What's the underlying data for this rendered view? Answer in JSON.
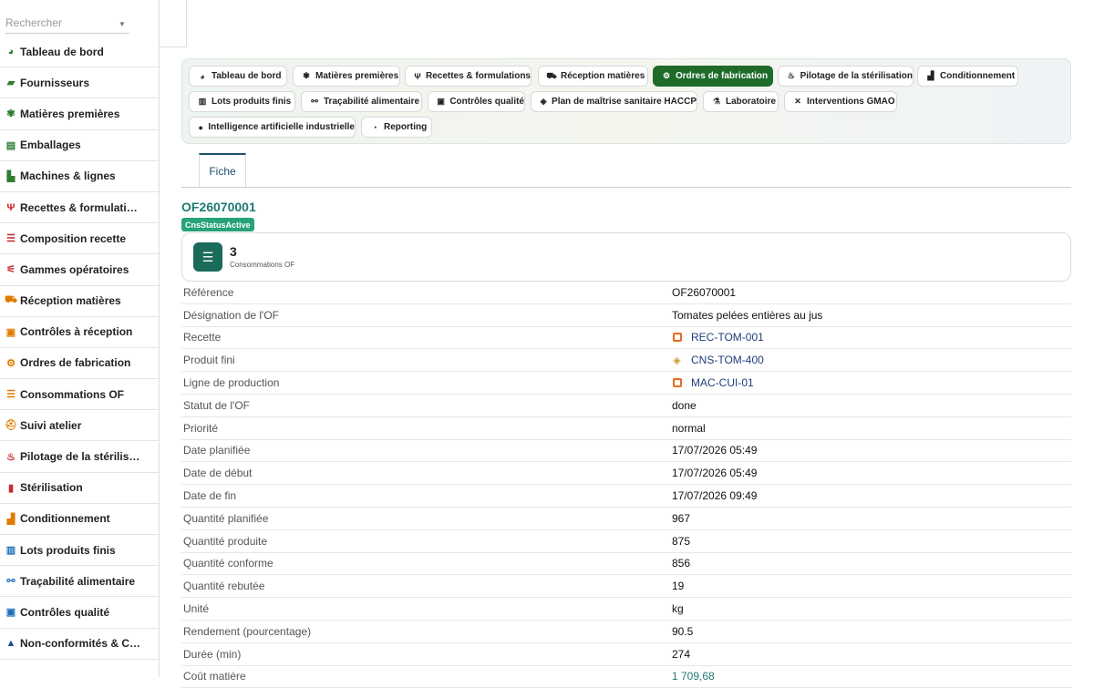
{
  "sidebar": {
    "search_placeholder": "Rechercher",
    "items": [
      {
        "label": "Tableau de bord",
        "icon": "gauge-icon",
        "glyph": "◕",
        "color": "#2e7d32"
      },
      {
        "label": "Fournisseurs",
        "icon": "truck-icon",
        "glyph": "▰",
        "color": "#2e7d32"
      },
      {
        "label": "Matières premières",
        "icon": "seedling-icon",
        "glyph": "✾",
        "color": "#2e7d32"
      },
      {
        "label": "Emballages",
        "icon": "box-icon",
        "glyph": "▤",
        "color": "#2e7d32"
      },
      {
        "label": "Machines & lignes",
        "icon": "factory-icon",
        "glyph": "▙",
        "color": "#2e7d32"
      },
      {
        "label": "Recettes & formulati…",
        "icon": "utensils-icon",
        "glyph": "Ψ",
        "color": "#c62828"
      },
      {
        "label": "Composition recette",
        "icon": "list-icon",
        "glyph": "☰",
        "color": "#c62828"
      },
      {
        "label": "Gammes opératoires",
        "icon": "diagram-icon",
        "glyph": "⚟",
        "color": "#c62828"
      },
      {
        "label": "Réception matières",
        "icon": "dolly-icon",
        "glyph": "⛟",
        "color": "#e07b00"
      },
      {
        "label": "Contrôles à réception",
        "icon": "clipboard-check-icon",
        "glyph": "▣",
        "color": "#e07b00"
      },
      {
        "label": "Ordres de fabrication",
        "icon": "gears-icon",
        "glyph": "⚙",
        "color": "#e07b00"
      },
      {
        "label": "Consommations OF",
        "icon": "list-icon",
        "glyph": "☰",
        "color": "#e07b00"
      },
      {
        "label": "Suivi atelier",
        "icon": "helmet-icon",
        "glyph": "⛑",
        "color": "#e07b00"
      },
      {
        "label": "Pilotage de la stérilis…",
        "icon": "fire-icon",
        "glyph": "♨",
        "color": "#c62828"
      },
      {
        "label": "Stérilisation",
        "icon": "thermometer-icon",
        "glyph": "▮",
        "color": "#c62828"
      },
      {
        "label": "Conditionnement",
        "icon": "boxes-icon",
        "glyph": "▟",
        "color": "#e07b00"
      },
      {
        "label": "Lots produits finis",
        "icon": "barcode-icon",
        "glyph": "▥",
        "color": "#1e6fb8"
      },
      {
        "label": "Traçabilité alimentaire",
        "icon": "sitemap-icon",
        "glyph": "⚯",
        "color": "#1e6fb8"
      },
      {
        "label": "Contrôles qualité",
        "icon": "clipboard-check-icon",
        "glyph": "▣",
        "color": "#1e6fb8"
      },
      {
        "label": "Non-conformités & C…",
        "icon": "warning-icon",
        "glyph": "▲",
        "color": "#1e4e8e"
      }
    ]
  },
  "tabs": {
    "pills": [
      {
        "label": "Tableau de bord",
        "icon": "gauge-icon",
        "glyph": "◕",
        "active": false
      },
      {
        "label": "Matières premières",
        "icon": "seedling-icon",
        "glyph": "✾",
        "active": false
      },
      {
        "label": "Recettes & formulations",
        "icon": "utensils-icon",
        "glyph": "Ψ",
        "active": false
      },
      {
        "label": "Réception matières",
        "icon": "dolly-icon",
        "glyph": "⛟",
        "active": false
      },
      {
        "label": "Ordres de fabrication",
        "icon": "gears-icon",
        "glyph": "⚙",
        "active": true
      },
      {
        "label": "Pilotage de la stérilisation",
        "icon": "fire-icon",
        "glyph": "♨",
        "active": false
      },
      {
        "label": "Conditionnement",
        "icon": "boxes-icon",
        "glyph": "▟",
        "active": false
      },
      {
        "label": "Lots produits finis",
        "icon": "barcode-icon",
        "glyph": "▥",
        "active": false
      },
      {
        "label": "Traçabilité alimentaire",
        "icon": "sitemap-icon",
        "glyph": "⚯",
        "active": false
      },
      {
        "label": "Contrôles qualité",
        "icon": "clipboard-check-icon",
        "glyph": "▣",
        "active": false
      },
      {
        "label": "Plan de maîtrise sanitaire HACCP",
        "icon": "shield-icon",
        "glyph": "◈",
        "active": false
      },
      {
        "label": "Laboratoire",
        "icon": "flask-icon",
        "glyph": "⚗",
        "active": false
      },
      {
        "label": "Interventions GMAO",
        "icon": "tools-icon",
        "glyph": "✕",
        "active": false
      },
      {
        "label": "Intelligence artificielle industrielle",
        "icon": "lightbulb-icon",
        "glyph": "●",
        "active": false
      },
      {
        "label": "Reporting",
        "icon": "pie-chart-icon",
        "glyph": "◔",
        "active": false
      }
    ],
    "fiche_label": "Fiche"
  },
  "record": {
    "title": "OF26070001",
    "status_badge": "CnsStatusActive",
    "stat": {
      "value": "3",
      "label": "Consommations OF"
    },
    "fields": [
      {
        "label": "Référence",
        "value": "OF26070001",
        "kind": "text"
      },
      {
        "label": "Désignation de l'OF",
        "value": "Tomates pelées entières au jus",
        "kind": "text"
      },
      {
        "label": "Recette",
        "value": "REC-TOM-001",
        "kind": "link",
        "icon": "recipe-box-icon"
      },
      {
        "label": "Produit fini",
        "value": "CNS-TOM-400",
        "kind": "link",
        "icon": "cube-icon"
      },
      {
        "label": "Ligne de production",
        "value": "MAC-CUI-01",
        "kind": "link",
        "icon": "machine-box-icon"
      },
      {
        "label": "Statut de l'OF",
        "value": "done",
        "kind": "text"
      },
      {
        "label": "Priorité",
        "value": "normal",
        "kind": "text"
      },
      {
        "label": "Date planifiée",
        "value": "17/07/2026 05:49",
        "kind": "text"
      },
      {
        "label": "Date de début",
        "value": "17/07/2026 05:49",
        "kind": "text"
      },
      {
        "label": "Date de fin",
        "value": "17/07/2026 09:49",
        "kind": "text"
      },
      {
        "label": "Quantité planifiée",
        "value": "967",
        "kind": "text"
      },
      {
        "label": "Quantité produite",
        "value": "875",
        "kind": "text"
      },
      {
        "label": "Quantité conforme",
        "value": "856",
        "kind": "text"
      },
      {
        "label": "Quantité rebutée",
        "value": "19",
        "kind": "text"
      },
      {
        "label": "Unité",
        "value": "kg",
        "kind": "text"
      },
      {
        "label": "Rendement (pourcentage)",
        "value": "90.5",
        "kind": "text"
      },
      {
        "label": "Durée (min)",
        "value": "274",
        "kind": "text"
      },
      {
        "label": "Coût matière",
        "value": "1 709,68",
        "kind": "num-link"
      }
    ]
  }
}
